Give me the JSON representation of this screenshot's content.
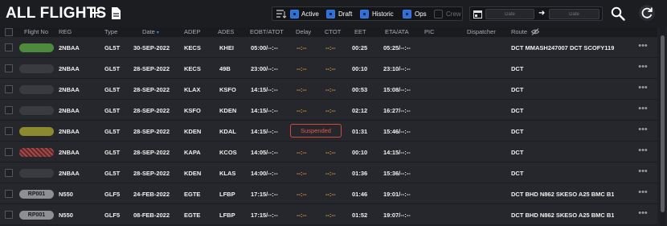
{
  "header": {
    "title": "ALL FLIGHTS",
    "add_icon": "plus-icon",
    "doc_icon": "document-icon"
  },
  "filters": [
    {
      "label": "Active",
      "checked": true
    },
    {
      "label": "Draft",
      "checked": true
    },
    {
      "label": "Historic",
      "checked": true
    },
    {
      "label": "Ops",
      "checked": true
    },
    {
      "label": "Crew",
      "checked": false
    }
  ],
  "date_range": {
    "from_placeholder": "Date",
    "to_placeholder": "Date",
    "arrow": "➜"
  },
  "columns": {
    "flight_no": "Flight No",
    "reg": "REG",
    "type": "Type",
    "date": "Date",
    "date_sort": "▾",
    "adep": "ADEP",
    "ades": "ADES",
    "eobt": "EOBT/ATOT",
    "delay": "Delay",
    "ctot": "CTOT",
    "eet": "EET",
    "eta": "ETA/ATA",
    "pic": "PIC",
    "dispatcher": "Dispatcher",
    "route": "Route"
  },
  "colors": {
    "active_filter": "#2f6fd6",
    "dash": "#e5a23d",
    "suspended": "#e2594a",
    "pill_green": "#4e8a3c",
    "pill_olive": "#8c8a2e",
    "pill_gray": "#3a3b40"
  },
  "rows": [
    {
      "flight_no": "",
      "status": "green",
      "reg": "2NBAA",
      "type": "GL5T",
      "date": "30-SEP-2022",
      "adep": "KECS",
      "ades": "KHEI",
      "eobt": "05:00/--:--",
      "delay": "--:--",
      "ctot": "--:--",
      "eet": "00:25",
      "eta": "05:25/--:--",
      "route": "DCT MMASH247007 DCT SCOFY119"
    },
    {
      "flight_no": "",
      "status": "gray",
      "reg": "2NBAA",
      "type": "GL5T",
      "date": "28-SEP-2022",
      "adep": "KECS",
      "ades": "49B",
      "eobt": "23:00/--:--",
      "delay": "--:--",
      "ctot": "--:--",
      "eet": "00:10",
      "eta": "23:10/--:--",
      "route": "DCT"
    },
    {
      "flight_no": "",
      "status": "gray",
      "reg": "2NBAA",
      "type": "GL5T",
      "date": "28-SEP-2022",
      "adep": "KLAX",
      "ades": "KSFO",
      "eobt": "14:15/--:--",
      "delay": "--:--",
      "ctot": "--:--",
      "eet": "00:53",
      "eta": "15:08/--:--",
      "route": "DCT"
    },
    {
      "flight_no": "",
      "status": "gray",
      "reg": "2NBAA",
      "type": "GL5T",
      "date": "28-SEP-2022",
      "adep": "KSFO",
      "ades": "KDEN",
      "eobt": "14:15/--:--",
      "delay": "--:--",
      "ctot": "--:--",
      "eet": "02:12",
      "eta": "16:27/--:--",
      "route": "DCT"
    },
    {
      "flight_no": "",
      "status": "olive",
      "reg": "2NBAA",
      "type": "GL5T",
      "date": "28-SEP-2022",
      "adep": "KDEN",
      "ades": "KDAL",
      "eobt": "14:15/--:--",
      "delay": "Suspended",
      "ctot": "",
      "eet": "01:31",
      "eta": "15:46/--:--",
      "route": "DCT"
    },
    {
      "flight_no": "",
      "status": "hatch",
      "reg": "2NBAA",
      "type": "GL5T",
      "date": "28-SEP-2022",
      "adep": "KAPA",
      "ades": "KCOS",
      "eobt": "14:05/--:--",
      "delay": "--:--",
      "ctot": "--:--",
      "eet": "00:10",
      "eta": "14:15/--:--",
      "route": "DCT"
    },
    {
      "flight_no": "",
      "status": "gray",
      "reg": "2NBAA",
      "type": "GL5T",
      "date": "28-SEP-2022",
      "adep": "KDEN",
      "ades": "KLAS",
      "eobt": "14:00/--:--",
      "delay": "--:--",
      "ctot": "--:--",
      "eet": "01:36",
      "eta": "15:36/--:--",
      "route": "DCT"
    },
    {
      "flight_no": "RP001",
      "status": "label",
      "reg": "N550",
      "type": "GLF5",
      "date": "24-FEB-2022",
      "adep": "EGTE",
      "ades": "LFBP",
      "eobt": "17:15/--:--",
      "delay": "--:--",
      "ctot": "--:--",
      "eet": "01:46",
      "eta": "19:01/--:--",
      "route": "DCT BHD N862 SKESO A25 BMC B19"
    },
    {
      "flight_no": "RP001",
      "status": "label",
      "reg": "N550",
      "type": "GLF5",
      "date": "08-FEB-2022",
      "adep": "EGTE",
      "ades": "LFBP",
      "eobt": "17:15/--:--",
      "delay": "--:--",
      "ctot": "--:--",
      "eet": "01:52",
      "eta": "19:07/--:--",
      "route": "DCT BHD N862 SKESO A25 BMC B19"
    }
  ],
  "row_menu": "•••"
}
